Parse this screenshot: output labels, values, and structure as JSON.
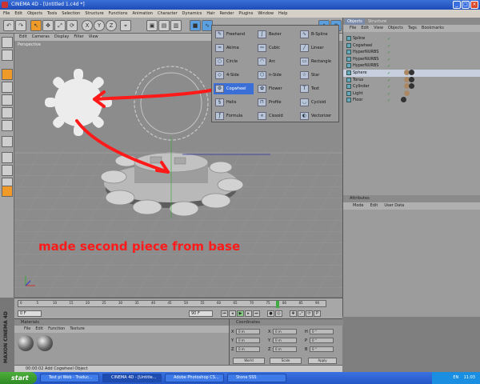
{
  "window": {
    "title": "CINEMA 4D - [Untitled 1.c4d *]"
  },
  "menubar": {
    "items": [
      "File",
      "Edit",
      "Objects",
      "Tools",
      "Selection",
      "Structure",
      "Functions",
      "Animation",
      "Character",
      "Dynamics",
      "Hair",
      "Render",
      "Plugins",
      "Window",
      "Help"
    ]
  },
  "toolbar": {
    "axes": [
      "X",
      "Y",
      "Z"
    ]
  },
  "viewport": {
    "menu": [
      "Edit",
      "Cameras",
      "Display",
      "Filter",
      "View"
    ],
    "label": "Perspective",
    "annotation": "made second piece from base",
    "annotation_color": "#ff1a1a"
  },
  "spline_menu": {
    "items": [
      {
        "label": "Freehand",
        "icon": "freehand-icon"
      },
      {
        "label": "Bezier",
        "icon": "bezier-icon"
      },
      {
        "label": "B-Spline",
        "icon": "bspline-icon"
      },
      {
        "label": "Akima",
        "icon": "akima-icon"
      },
      {
        "label": "Cubic",
        "icon": "cubic-icon"
      },
      {
        "label": "Linear",
        "icon": "linear-icon"
      },
      {
        "label": "Circle",
        "icon": "circle-icon"
      },
      {
        "label": "Arc",
        "icon": "arc-icon"
      },
      {
        "label": "Rectangle",
        "icon": "rectangle-icon"
      },
      {
        "label": "4-Side",
        "icon": "four-side-icon"
      },
      {
        "label": "n-Side",
        "icon": "n-side-icon"
      },
      {
        "label": "Star",
        "icon": "star-icon"
      },
      {
        "label": "Cogwheel",
        "icon": "cogwheel-icon"
      },
      {
        "label": "Flower",
        "icon": "flower-icon"
      },
      {
        "label": "Text",
        "icon": "text-icon"
      },
      {
        "label": "Helix",
        "icon": "helix-icon"
      },
      {
        "label": "Profile",
        "icon": "profile-icon"
      },
      {
        "label": "Cycloid",
        "icon": "cycloid-icon"
      },
      {
        "label": "Formula",
        "icon": "formula-icon"
      },
      {
        "label": "Cissoid",
        "icon": "cissoid-icon"
      },
      {
        "label": "Vectorizer",
        "icon": "vectorizer-icon"
      }
    ],
    "selected": "Cogwheel"
  },
  "objects": {
    "tabs": [
      "Objects",
      "Structure"
    ],
    "menu": [
      "File",
      "Edit",
      "View",
      "Objects",
      "Tags",
      "Bookmarks"
    ],
    "items": [
      {
        "name": "Spline",
        "depth": 0
      },
      {
        "name": "Cogwheel",
        "depth": 0
      },
      {
        "name": "HyperNURBS",
        "depth": 0
      },
      {
        "name": "HyperNURBS",
        "depth": 0
      },
      {
        "name": "HyperNURBS",
        "depth": 0
      },
      {
        "name": "Sphere",
        "depth": 0,
        "selected": true
      },
      {
        "name": "Torus",
        "depth": 0
      },
      {
        "name": "Cylinder",
        "depth": 0
      },
      {
        "name": "Light",
        "depth": 0
      },
      {
        "name": "Floor",
        "depth": 0
      }
    ]
  },
  "attributes": {
    "title": "Attributes",
    "menu": [
      "Mode",
      "Edit",
      "User Data"
    ]
  },
  "timeline": {
    "ticks": [
      "0",
      "5",
      "10",
      "15",
      "20",
      "25",
      "30",
      "35",
      "40",
      "45",
      "50",
      "55",
      "60",
      "65",
      "70",
      "75",
      "80",
      "85",
      "90"
    ],
    "frame_field": "0 F",
    "start_field": "0 F",
    "end_field": "90 F"
  },
  "materials": {
    "title": "Materials",
    "menu": [
      "File",
      "Edit",
      "Function",
      "Texture"
    ]
  },
  "coordinates": {
    "title": "Coordinates",
    "rows": [
      [
        "X",
        "0 m",
        "X",
        "0 m",
        "H",
        "0 °"
      ],
      [
        "Y",
        "0 m",
        "Y",
        "0 m",
        "P",
        "0 °"
      ],
      [
        "Z",
        "0 m",
        "Z",
        "0 m",
        "B",
        "0 °"
      ]
    ],
    "modes": [
      "World",
      "Scale",
      "Apply"
    ]
  },
  "status": {
    "text": "00:00:02  Add Cogwheel Object"
  },
  "branding": {
    "side_logo": "MAXON CINEMA 4D"
  },
  "taskbar": {
    "start": "start",
    "tasks": [
      "Test pi Web - Traduc...",
      "CINEMA 4D - [Untitle...",
      "Adobe Photoshop CS...",
      "Stone SSS"
    ],
    "active_index": 1,
    "lang": "EN",
    "clock": "11:03"
  }
}
